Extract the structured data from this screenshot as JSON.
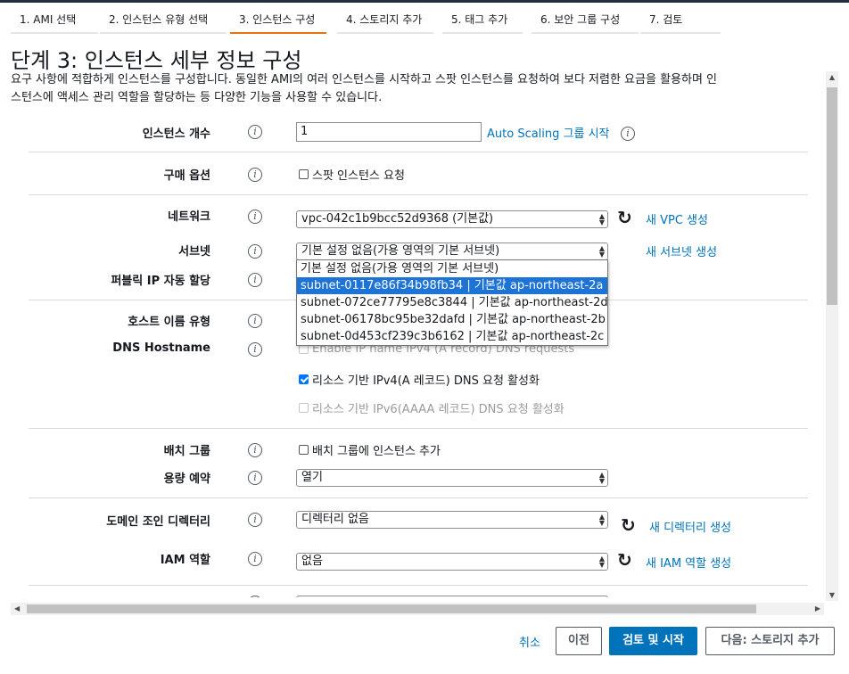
{
  "tabs": [
    {
      "label": "1. AMI 선택",
      "active": false
    },
    {
      "label": "2. 인스턴스 유형 선택",
      "active": false
    },
    {
      "label": "3. 인스턴스 구성",
      "active": true
    },
    {
      "label": "4. 스토리지 추가",
      "active": false
    },
    {
      "label": "5. 태그 추가",
      "active": false
    },
    {
      "label": "6. 보안 그룹 구성",
      "active": false
    },
    {
      "label": "7. 검토",
      "active": false
    }
  ],
  "page": {
    "title": "단계 3: 인스턴스 세부 정보 구성",
    "description_line1": "요구 사항에 적합하게 인스턴스를 구성합니다. 동일한 AMI의 여러 인스턴스를 시작하고 스팟 인스턴스를 요청하여 보다 저렴한 요금을 활용하며 인",
    "description_line2": "스턴스에 액세스 관리 역할을 할당하는 등 다양한 기능을 사용할 수 있습니다."
  },
  "info_glyph": "i",
  "form": {
    "instance_count": {
      "label": "인스턴스 개수",
      "value": "1",
      "link": "Auto Scaling 그룹 시작"
    },
    "purchase_option": {
      "label": "구매 옵션",
      "checkbox": "스팟 인스턴스 요청",
      "checked": false
    },
    "network": {
      "label": "네트워크",
      "value": "vpc-042c1b9bcc52d9368 (기본값)",
      "link": "새 VPC 생성"
    },
    "subnet": {
      "label": "서브넷",
      "value": "기본 설정 없음(가용 영역의 기본 서브넷)",
      "link": "새 서브넷 생성",
      "options": [
        "기본 설정 없음(가용 영역의 기본 서브넷)",
        "subnet-0117e86f34b98fb34 | 기본값 ap-northeast-2a",
        "subnet-072ce77795e8c3844 | 기본값 ap-northeast-2d",
        "subnet-06178bc95be32dafd | 기본값 ap-northeast-2b",
        "subnet-0d453cf239c3b6162 | 기본값 ap-northeast-2c"
      ],
      "highlighted_index": 1
    },
    "public_ip": {
      "label": "퍼블릭 IP 자동 할당"
    },
    "hostname_type": {
      "label": "호스트 이름 유형"
    },
    "dns_hostname": {
      "label": "DNS Hostname",
      "opt1": "Enable IP name IPv4 (A record) DNS requests",
      "opt2": "리소스 기반 IPv4(A 레코드) DNS 요청 활성화",
      "opt2_checked": true,
      "opt3": "리소스 기반 IPv6(AAAA 레코드) DNS 요청 활성화",
      "opt3_checked": false
    },
    "placement_group": {
      "label": "배치 그룹",
      "checkbox": "배치 그룹에 인스턴스 추가",
      "checked": false
    },
    "capacity_reservation": {
      "label": "용량 예약",
      "value": "열기"
    },
    "domain_directory": {
      "label": "도메인 조인 디렉터리",
      "value": "디렉터리 없음",
      "link": "새 디렉터리 생성"
    },
    "iam_role": {
      "label": "IAM 역할",
      "value": "없음",
      "link": "새 IAM 역할 생성"
    }
  },
  "footer": {
    "cancel": "취소",
    "previous": "이전",
    "review_launch": "검토 및 시작",
    "next": "다음: 스토리지 추가"
  },
  "colors": {
    "accent": "#ec7211",
    "link": "#0073bb",
    "primary_button": "#0073bb",
    "highlight": "#1e73d6"
  }
}
